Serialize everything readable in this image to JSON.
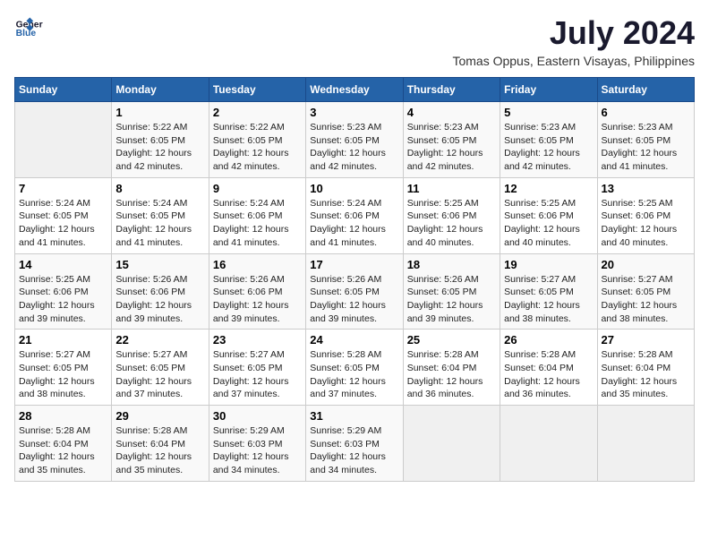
{
  "logo": {
    "line1": "General",
    "line2": "Blue"
  },
  "title": "July 2024",
  "subtitle": "Tomas Oppus, Eastern Visayas, Philippines",
  "days_of_week": [
    "Sunday",
    "Monday",
    "Tuesday",
    "Wednesday",
    "Thursday",
    "Friday",
    "Saturday"
  ],
  "weeks": [
    [
      {
        "day": "",
        "info": ""
      },
      {
        "day": "1",
        "info": "Sunrise: 5:22 AM\nSunset: 6:05 PM\nDaylight: 12 hours\nand 42 minutes."
      },
      {
        "day": "2",
        "info": "Sunrise: 5:22 AM\nSunset: 6:05 PM\nDaylight: 12 hours\nand 42 minutes."
      },
      {
        "day": "3",
        "info": "Sunrise: 5:23 AM\nSunset: 6:05 PM\nDaylight: 12 hours\nand 42 minutes."
      },
      {
        "day": "4",
        "info": "Sunrise: 5:23 AM\nSunset: 6:05 PM\nDaylight: 12 hours\nand 42 minutes."
      },
      {
        "day": "5",
        "info": "Sunrise: 5:23 AM\nSunset: 6:05 PM\nDaylight: 12 hours\nand 42 minutes."
      },
      {
        "day": "6",
        "info": "Sunrise: 5:23 AM\nSunset: 6:05 PM\nDaylight: 12 hours\nand 41 minutes."
      }
    ],
    [
      {
        "day": "7",
        "info": ""
      },
      {
        "day": "8",
        "info": "Sunrise: 5:24 AM\nSunset: 6:05 PM\nDaylight: 12 hours\nand 41 minutes."
      },
      {
        "day": "9",
        "info": "Sunrise: 5:24 AM\nSunset: 6:06 PM\nDaylight: 12 hours\nand 41 minutes."
      },
      {
        "day": "10",
        "info": "Sunrise: 5:24 AM\nSunset: 6:06 PM\nDaylight: 12 hours\nand 41 minutes."
      },
      {
        "day": "11",
        "info": "Sunrise: 5:25 AM\nSunset: 6:06 PM\nDaylight: 12 hours\nand 40 minutes."
      },
      {
        "day": "12",
        "info": "Sunrise: 5:25 AM\nSunset: 6:06 PM\nDaylight: 12 hours\nand 40 minutes."
      },
      {
        "day": "13",
        "info": "Sunrise: 5:25 AM\nSunset: 6:06 PM\nDaylight: 12 hours\nand 40 minutes."
      }
    ],
    [
      {
        "day": "14",
        "info": ""
      },
      {
        "day": "15",
        "info": "Sunrise: 5:26 AM\nSunset: 6:06 PM\nDaylight: 12 hours\nand 39 minutes."
      },
      {
        "day": "16",
        "info": "Sunrise: 5:26 AM\nSunset: 6:06 PM\nDaylight: 12 hours\nand 39 minutes."
      },
      {
        "day": "17",
        "info": "Sunrise: 5:26 AM\nSunset: 6:05 PM\nDaylight: 12 hours\nand 39 minutes."
      },
      {
        "day": "18",
        "info": "Sunrise: 5:26 AM\nSunset: 6:05 PM\nDaylight: 12 hours\nand 39 minutes."
      },
      {
        "day": "19",
        "info": "Sunrise: 5:27 AM\nSunset: 6:05 PM\nDaylight: 12 hours\nand 38 minutes."
      },
      {
        "day": "20",
        "info": "Sunrise: 5:27 AM\nSunset: 6:05 PM\nDaylight: 12 hours\nand 38 minutes."
      }
    ],
    [
      {
        "day": "21",
        "info": ""
      },
      {
        "day": "22",
        "info": "Sunrise: 5:27 AM\nSunset: 6:05 PM\nDaylight: 12 hours\nand 37 minutes."
      },
      {
        "day": "23",
        "info": "Sunrise: 5:27 AM\nSunset: 6:05 PM\nDaylight: 12 hours\nand 37 minutes."
      },
      {
        "day": "24",
        "info": "Sunrise: 5:28 AM\nSunset: 6:05 PM\nDaylight: 12 hours\nand 37 minutes."
      },
      {
        "day": "25",
        "info": "Sunrise: 5:28 AM\nSunset: 6:04 PM\nDaylight: 12 hours\nand 36 minutes."
      },
      {
        "day": "26",
        "info": "Sunrise: 5:28 AM\nSunset: 6:04 PM\nDaylight: 12 hours\nand 36 minutes."
      },
      {
        "day": "27",
        "info": "Sunrise: 5:28 AM\nSunset: 6:04 PM\nDaylight: 12 hours\nand 35 minutes."
      }
    ],
    [
      {
        "day": "28",
        "info": "Sunrise: 5:28 AM\nSunset: 6:04 PM\nDaylight: 12 hours\nand 35 minutes."
      },
      {
        "day": "29",
        "info": "Sunrise: 5:28 AM\nSunset: 6:04 PM\nDaylight: 12 hours\nand 35 minutes."
      },
      {
        "day": "30",
        "info": "Sunrise: 5:29 AM\nSunset: 6:03 PM\nDaylight: 12 hours\nand 34 minutes."
      },
      {
        "day": "31",
        "info": "Sunrise: 5:29 AM\nSunset: 6:03 PM\nDaylight: 12 hours\nand 34 minutes."
      },
      {
        "day": "",
        "info": ""
      },
      {
        "day": "",
        "info": ""
      },
      {
        "day": "",
        "info": ""
      }
    ]
  ],
  "week1_day7_info": "Sunrise: 5:24 AM\nSunset: 6:05 PM\nDaylight: 12 hours\nand 41 minutes.",
  "week3_day14_info": "Sunrise: 5:25 AM\nSunset: 6:06 PM\nDaylight: 12 hours\nand 39 minutes.",
  "week4_day21_info": "Sunrise: 5:27 AM\nSunset: 6:05 PM\nDaylight: 12 hours\nand 38 minutes."
}
